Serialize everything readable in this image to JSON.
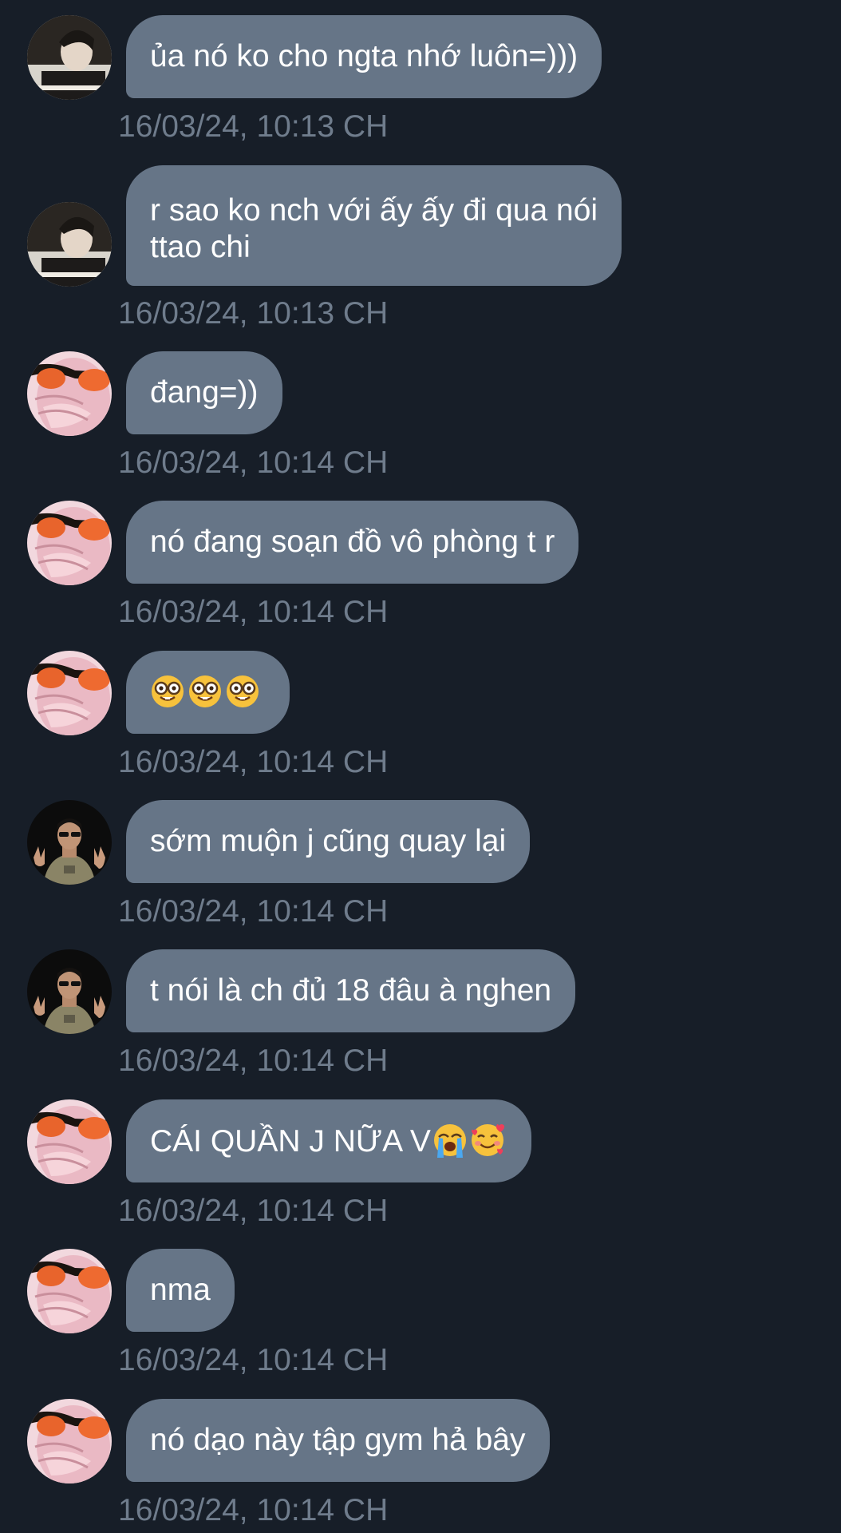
{
  "messages": [
    {
      "sender": "user-a",
      "lines": [
        "ủa nó ko cho ngta nhớ luôn=)))"
      ],
      "timestamp": "16/03/24, 10:13 CH"
    },
    {
      "sender": "user-a",
      "lines": [
        "r sao ko nch với ấy ấy đi qua nói",
        "ttao chi"
      ],
      "timestamp": "16/03/24, 10:13 CH"
    },
    {
      "sender": "user-b",
      "lines": [
        "đang=))"
      ],
      "timestamp": "16/03/24, 10:14 CH"
    },
    {
      "sender": "user-b",
      "lines": [
        "nó đang soạn đồ vô phòng t r"
      ],
      "timestamp": "16/03/24, 10:14 CH"
    },
    {
      "sender": "user-b",
      "emojis": [
        "nerd-face-emoji",
        "nerd-face-emoji",
        "nerd-face-emoji"
      ],
      "timestamp": "16/03/24, 10:14 CH"
    },
    {
      "sender": "user-c",
      "lines": [
        "sớm muộn j cũng quay lại"
      ],
      "timestamp": "16/03/24, 10:14 CH"
    },
    {
      "sender": "user-c",
      "lines": [
        "t nói là ch đủ 18 đâu à nghen"
      ],
      "timestamp": "16/03/24, 10:14 CH"
    },
    {
      "sender": "user-b",
      "lines": [
        "CÁI QUẦN J NỮA V"
      ],
      "trailing_emojis": [
        "loudly-crying-face-emoji",
        "smiling-face-with-hearts-emoji"
      ],
      "timestamp": "16/03/24, 10:14 CH"
    },
    {
      "sender": "user-b",
      "lines": [
        "nma"
      ],
      "timestamp": "16/03/24, 10:14 CH"
    },
    {
      "sender": "user-b",
      "lines": [
        "nó dạo này tập gym hả bây"
      ],
      "timestamp": "16/03/24, 10:14 CH"
    }
  ],
  "colors": {
    "background": "#171e28",
    "bubble": "#667587",
    "timestamp": "#6f7c8c",
    "text": "#ffffff"
  }
}
